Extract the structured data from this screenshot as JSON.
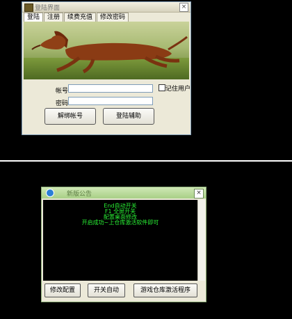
{
  "login_window": {
    "title": "登陆界面",
    "tabs": [
      "登陆",
      "注册",
      "续费充值",
      "修改密码"
    ],
    "account_label": "帐号:",
    "account_value": "",
    "password_label": "密码:",
    "password_value": "",
    "remember_label": "记住用户",
    "remember_checked": false,
    "unbind_button": "解绑帐号",
    "login_help_button": "登陆辅助",
    "close_glyph": "×"
  },
  "notice_window": {
    "title": "新版公告",
    "close_glyph": "×",
    "console_lines": [
      "End自动开关",
      "F1 全屏开关",
      "配置桌面修改",
      "开启成功~上仓库激活软件即可"
    ],
    "text_color": "#29f034",
    "buttons": [
      "修改配置",
      "开关自动",
      "游戏仓库激活程序"
    ]
  }
}
